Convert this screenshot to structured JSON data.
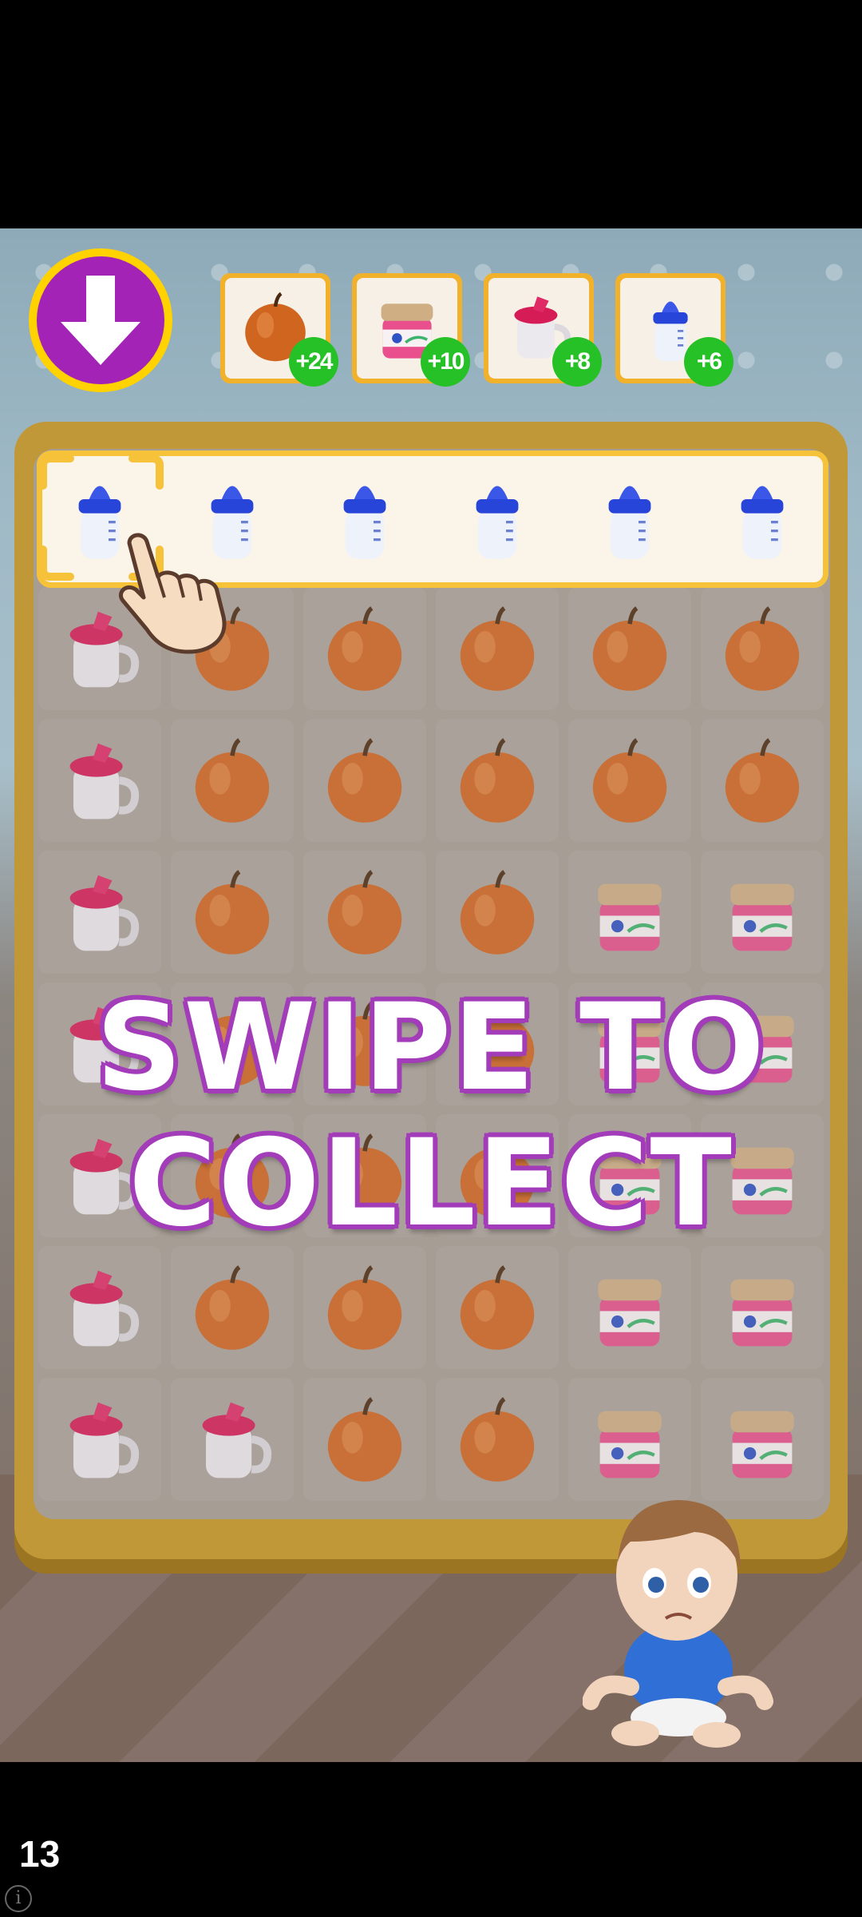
{
  "header": {
    "action_button_icon": "down-arrow-icon"
  },
  "goals": [
    {
      "item": "apple",
      "count_label": "+24"
    },
    {
      "item": "baby-food-jar",
      "count_label": "+10"
    },
    {
      "item": "sippy-cup",
      "count_label": "+8"
    },
    {
      "item": "baby-bottle",
      "count_label": "+6"
    }
  ],
  "board": {
    "rows": [
      [
        "bottle",
        "bottle",
        "bottle",
        "bottle",
        "bottle",
        "bottle"
      ],
      [
        "cup",
        "apple",
        "apple",
        "apple",
        "apple",
        "apple"
      ],
      [
        "cup",
        "apple",
        "apple",
        "apple",
        "apple",
        "apple"
      ],
      [
        "cup",
        "apple",
        "apple",
        "apple",
        "jar",
        "jar"
      ],
      [
        "cup",
        "apple",
        "apple",
        "apple",
        "jar",
        "jar"
      ],
      [
        "cup",
        "apple",
        "apple",
        "apple",
        "jar",
        "jar"
      ],
      [
        "cup",
        "apple",
        "apple",
        "apple",
        "jar",
        "jar"
      ],
      [
        "cup",
        "cup",
        "apple",
        "apple",
        "jar",
        "jar"
      ]
    ],
    "highlighted_row": 0
  },
  "tutorial": {
    "line1": "SWIPE TO",
    "line2": "COLLECT"
  },
  "footer": {
    "level_number": "13",
    "info_icon": "info-icon"
  },
  "colors": {
    "button_purple": "#a323b6",
    "button_ring": "#ffd200",
    "badge_green": "#26c126",
    "board_gold": "#c19838"
  }
}
